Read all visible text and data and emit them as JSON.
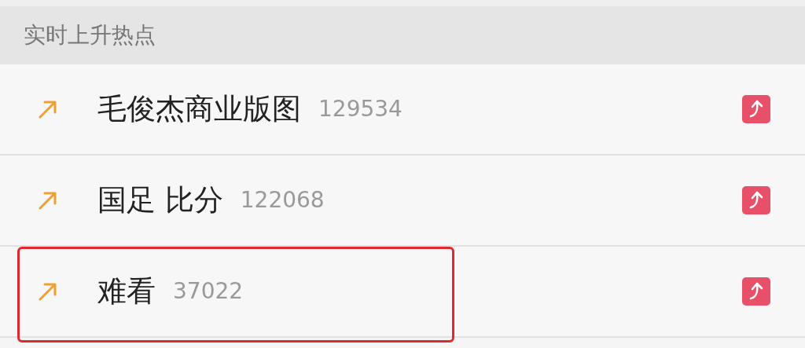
{
  "section_title": "实时上升热点",
  "rows": [
    {
      "title": "毛俊杰商业版图",
      "count": "129534",
      "highlighted": false
    },
    {
      "title": "国足 比分",
      "count": "122068",
      "highlighted": false
    },
    {
      "title": "难看",
      "count": "37022",
      "highlighted": true
    }
  ]
}
